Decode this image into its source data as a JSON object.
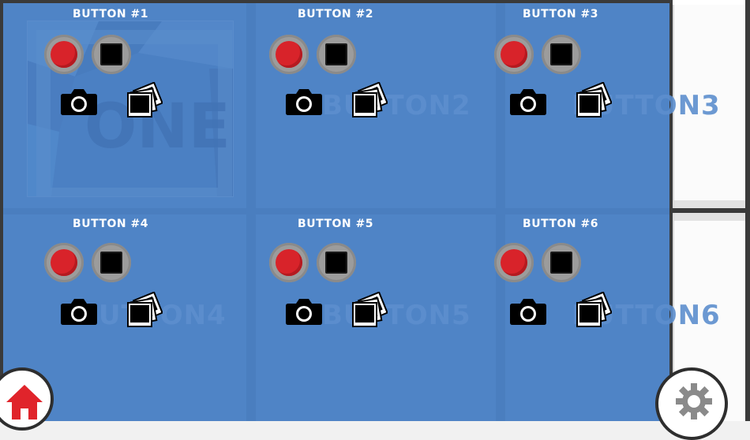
{
  "cells": [
    {
      "title": "BUTTON #1",
      "ghost": ""
    },
    {
      "title": "BUTTON #2",
      "ghost": "BUTTON2"
    },
    {
      "title": "BUTTON #3",
      "ghost": "BUTTON3"
    },
    {
      "title": "BUTTON #4",
      "ghost": "BUTTON4"
    },
    {
      "title": "BUTTON #5",
      "ghost": "BUTTON5"
    },
    {
      "title": "BUTTON #6",
      "ghost": "BUTTON6"
    }
  ],
  "artwork": {
    "word": "ONE"
  },
  "icons": {
    "record": "record-icon",
    "stop": "stop-icon",
    "camera": "camera-icon",
    "gallery": "photo-gallery-icon",
    "home": "home-icon",
    "settings": "gear-icon"
  },
  "colors": {
    "panel": "#4f84c6",
    "record": "#d8232a",
    "home": "#e0242b",
    "frame": "#3a3a3a"
  }
}
